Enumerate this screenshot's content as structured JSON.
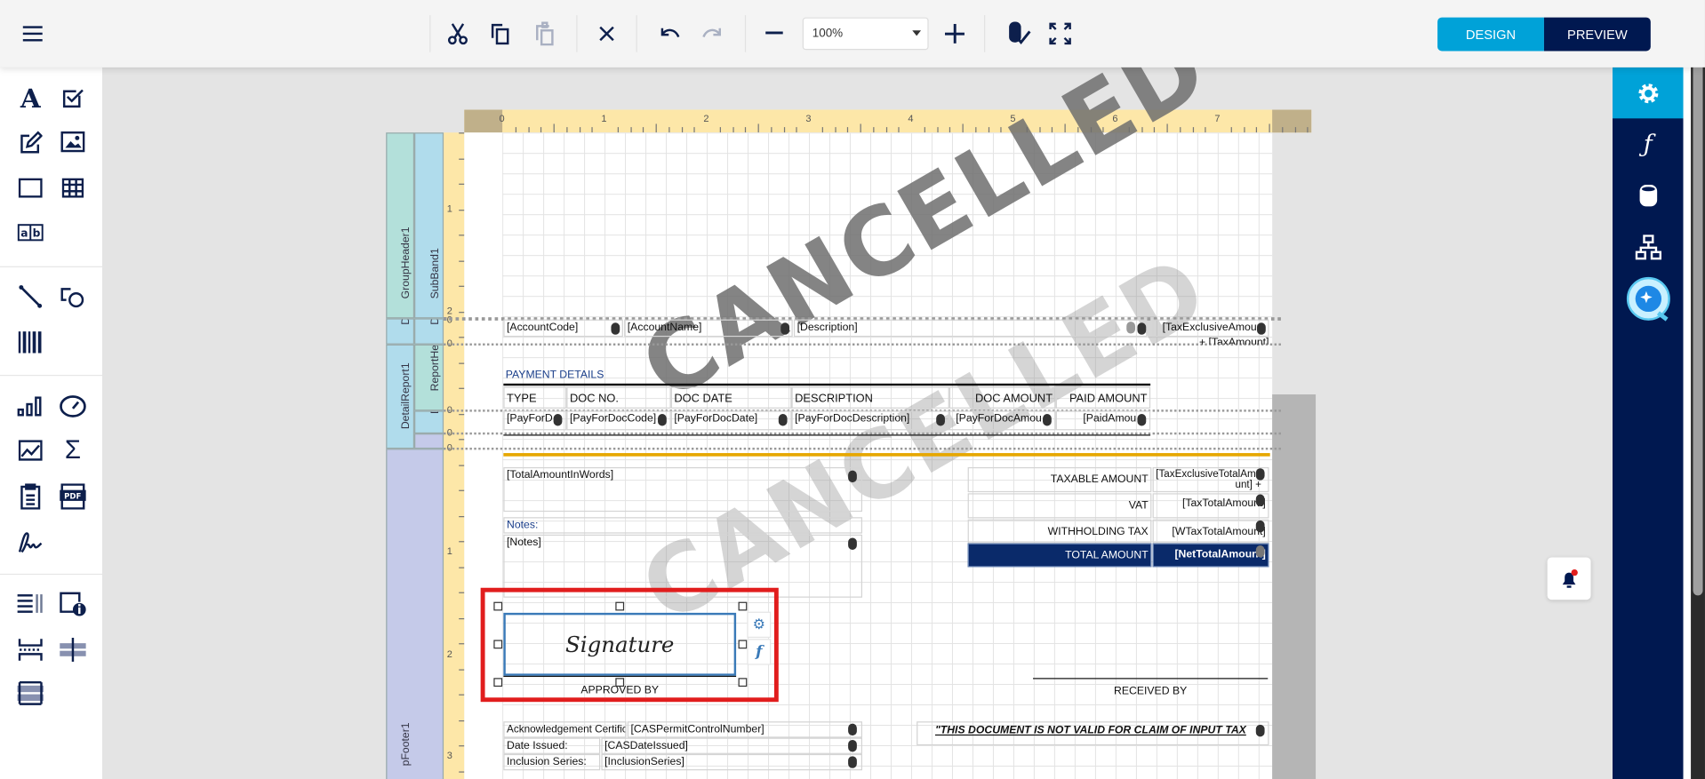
{
  "toolbar": {
    "menu_icon": "hamburger-icon",
    "zoom_value": "100%",
    "design_label": "DESIGN",
    "preview_label": "PREVIEW",
    "accent_color": "#00a2d8",
    "navy_color": "#001850"
  },
  "right_panel": {
    "items": [
      "properties",
      "expressions",
      "data-sources",
      "report-explorer",
      "ai-assistant"
    ]
  },
  "ruler": {
    "top": [
      "0",
      "1",
      "2",
      "3",
      "4",
      "5",
      "6",
      "7"
    ],
    "left": [
      "1",
      "2",
      "0",
      "0",
      "0",
      "0",
      "0",
      "1",
      "2",
      "3"
    ]
  },
  "bands": {
    "group_header": "GroupHeader1",
    "sub_band": "SubBand1",
    "de1": "De",
    "de2": "De",
    "detail_report": "DetailReport1",
    "report_header": "ReportHea",
    "de3": "De",
    "r": "R",
    "group_footer": "pFooter1"
  },
  "watermark": "CANCELLED",
  "detail": {
    "account_code": "[AccountCode]",
    "account_name": "[AccountName]",
    "description": "[Description]",
    "tax_exclusive": "[TaxExclusiveAmoun",
    "tax_amount": "+ [TaxAmount]"
  },
  "payment": {
    "title": "PAYMENT DETAILS",
    "headers": [
      "TYPE",
      "DOC NO.",
      "DOC DATE",
      "DESCRIPTION",
      "DOC AMOUNT",
      "PAID AMOUNT"
    ],
    "row": [
      "[PayForD",
      "[PayForDocCode]",
      "[PayForDocDate]",
      "[PayForDocDescription]",
      "[PayForDocAmou",
      "[PaidAmou"
    ]
  },
  "footer": {
    "total_words": "[TotalAmountInWords]",
    "notes_label": "Notes:",
    "notes": "[Notes]",
    "taxable_label": "TAXABLE AMOUNT",
    "taxable_value": "[TaxExclusiveTotalAmo unt] +",
    "vat_label": "VAT",
    "vat_value": "[TaxTotalAmount]",
    "wtax_label": "WITHHOLDING TAX",
    "wtax_value": "[WTaxTotalAmount]",
    "total_label": "TOTAL AMOUNT",
    "total_value": "[NetTotalAmount]",
    "signature": "Signature",
    "approved_by": "APPROVED BY",
    "received_by": "RECEIVED BY",
    "ack_label": "Acknowledgement Certificate No.:",
    "ack_value": "[CASPermitControlNumber]",
    "date_label": "Date Issued:",
    "date_value": "[CASDateIssued]",
    "incl_label": "Inclusion Series:",
    "incl_value": "[InclusionSeries]",
    "disclaimer": "\"THIS DOCUMENT IS NOT VALID FOR CLAIM OF INPUT TAX"
  }
}
